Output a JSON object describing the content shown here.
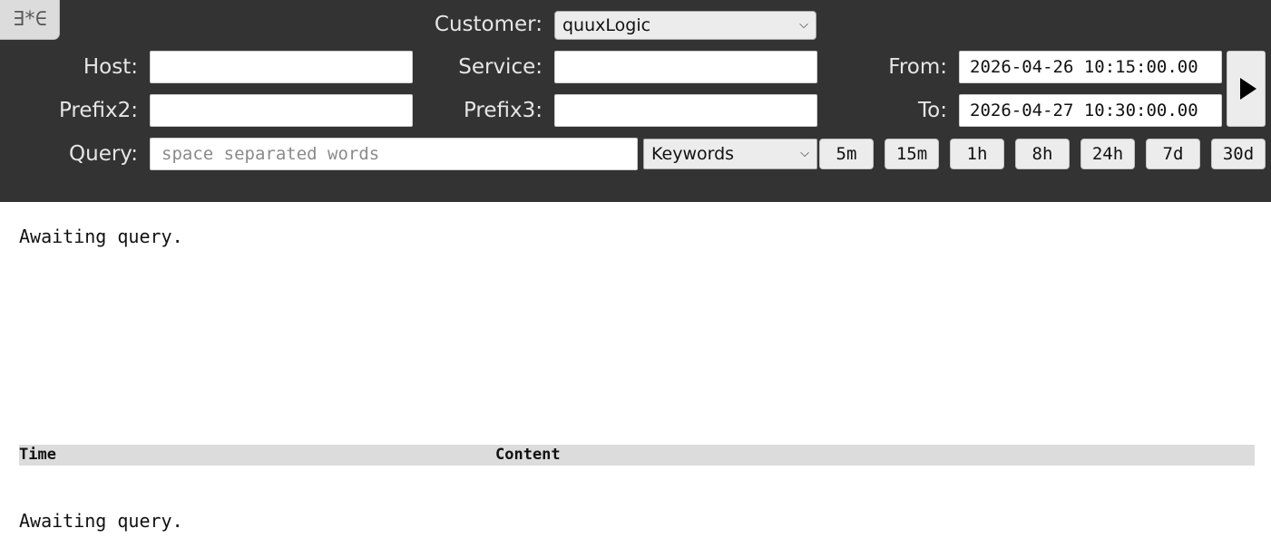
{
  "header": {
    "logo_glyph": "∃*∈",
    "customer": {
      "label": "Customer:",
      "value": "quuxLogic"
    },
    "host": {
      "label": "Host:",
      "value": ""
    },
    "service": {
      "label": "Service:",
      "value": ""
    },
    "prefix2": {
      "label": "Prefix2:",
      "value": ""
    },
    "prefix3": {
      "label": "Prefix3:",
      "value": ""
    },
    "query": {
      "label": "Query:",
      "value": "",
      "placeholder": "space separated words"
    },
    "query_mode": {
      "value": "Keywords"
    },
    "from": {
      "label": "From:",
      "value": "2026-04-26 10:15:00.00"
    },
    "to": {
      "label": "To:",
      "value": "2026-04-27 10:30:00.00"
    },
    "ranges": [
      "5m",
      "15m",
      "1h",
      "8h",
      "24h",
      "7d",
      "30d"
    ]
  },
  "summary": {
    "status": "Awaiting query."
  },
  "results": {
    "columns": {
      "time": "Time",
      "content": "Content"
    },
    "status": "Awaiting query."
  },
  "colors": {
    "header_bg": "#333333",
    "label_text": "#e6e6e6",
    "table_header_bg": "#dcdcdc"
  }
}
